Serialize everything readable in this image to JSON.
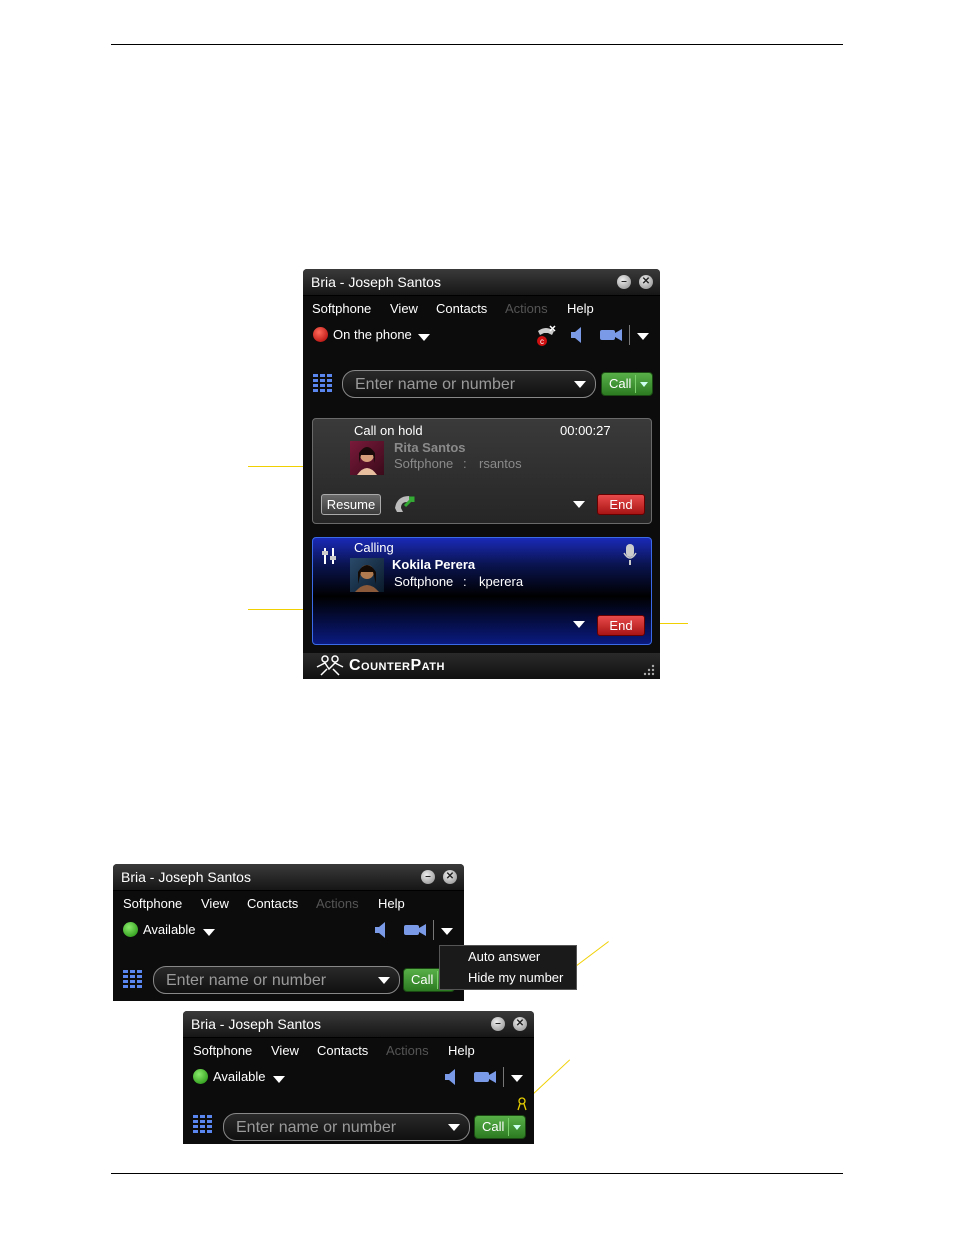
{
  "colors": {
    "callout": "#f0d000",
    "accent_blue": "#1a3cc8",
    "call_green": "#3d9a31",
    "end_red": "#c41e1e"
  },
  "window1": {
    "title": "Bria - Joseph Santos",
    "menu": [
      "Softphone",
      "View",
      "Contacts",
      "Actions",
      "Help"
    ],
    "status": "On the phone",
    "dial_placeholder": "Enter name or number",
    "call_label": "Call",
    "hold_panel": {
      "state": "Call on hold",
      "timer": "00:00:27",
      "name": "Rita Santos",
      "line": "Softphone",
      "sep": ":",
      "account": "rsantos",
      "resume_label": "Resume",
      "end_label": "End"
    },
    "calling_panel": {
      "state": "Calling",
      "name": "Kokila Perera",
      "line": "Softphone",
      "sep": ":",
      "account": "kperera",
      "end_label": "End"
    },
    "brand": "CounterPath"
  },
  "window2": {
    "title": "Bria - Joseph Santos",
    "menu": [
      "Softphone",
      "View",
      "Contacts",
      "Actions",
      "Help"
    ],
    "status": "Available",
    "dial_placeholder": "Enter name or number",
    "call_label": "Call",
    "dropdown_items": [
      "Auto answer",
      "Hide my number"
    ]
  },
  "window3": {
    "title": "Bria - Joseph Santos",
    "menu": [
      "Softphone",
      "View",
      "Contacts",
      "Actions",
      "Help"
    ],
    "status": "Available",
    "dial_placeholder": "Enter name or number",
    "call_label": "Call"
  }
}
